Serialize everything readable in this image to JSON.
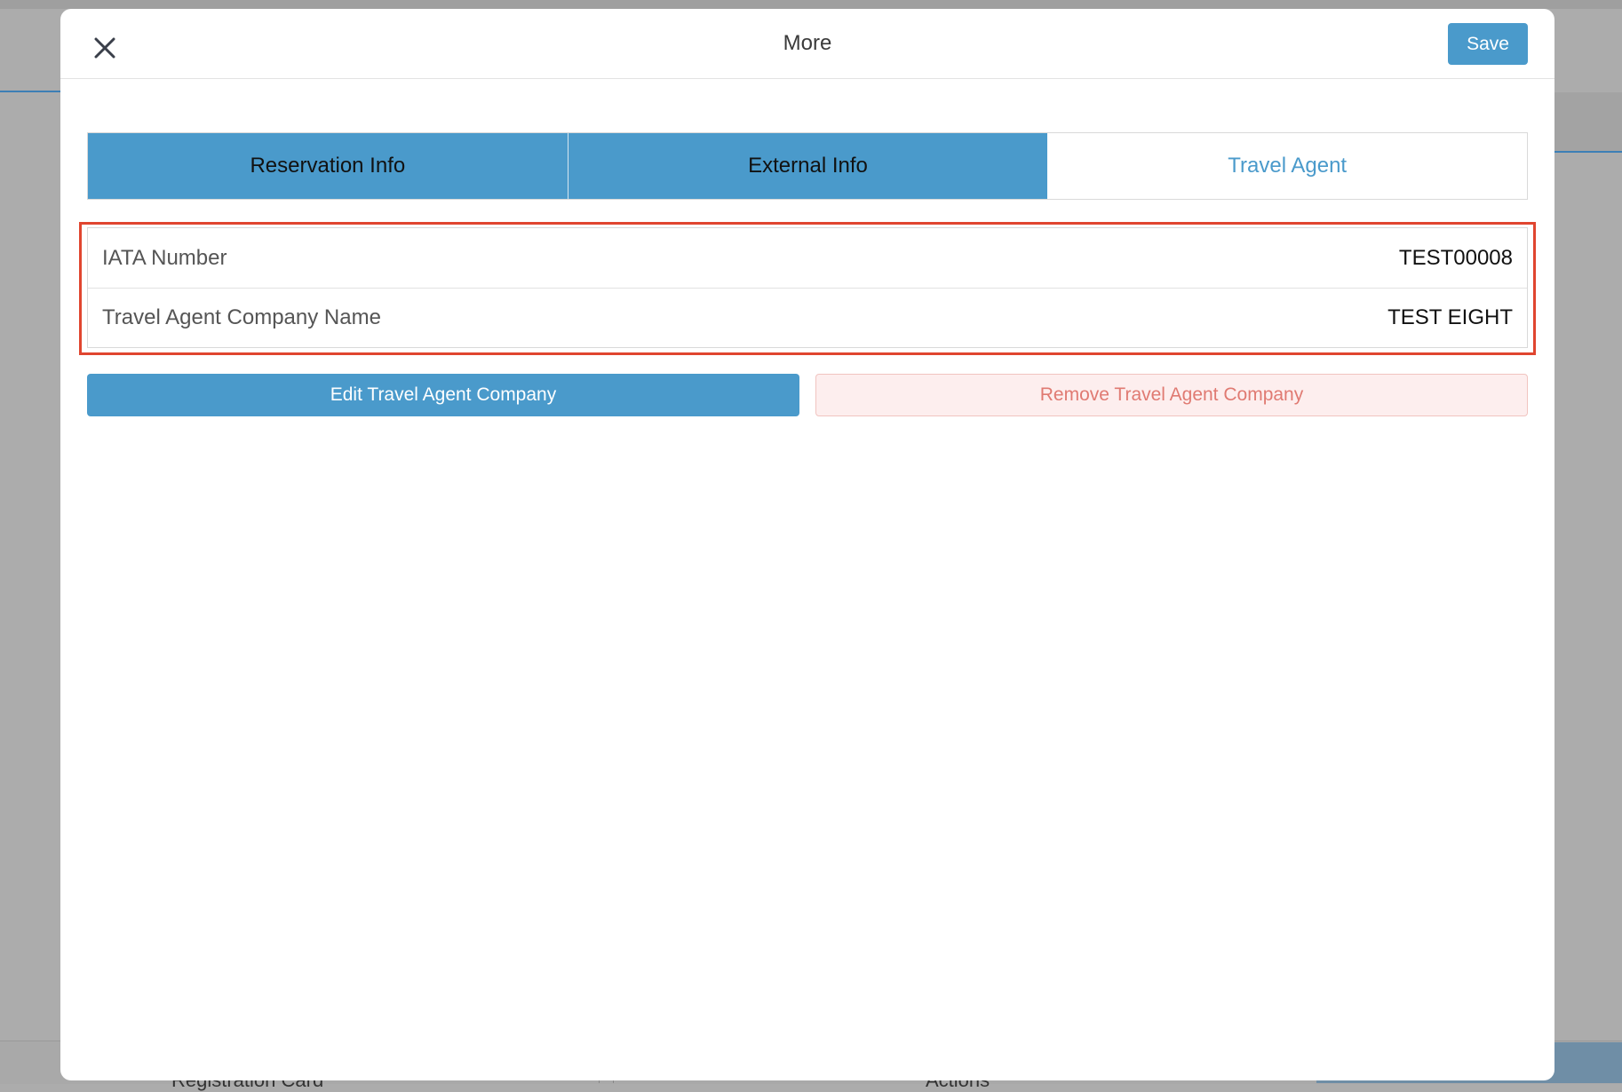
{
  "background": {
    "bottom_left_text": "Registration Card",
    "bottom_center_text": "Actions"
  },
  "modal": {
    "title": "More",
    "close_icon": "close-icon",
    "save_label": "Save"
  },
  "tabs": [
    {
      "label": "Reservation Info",
      "active": false
    },
    {
      "label": "External Info",
      "active": false
    },
    {
      "label": "Travel Agent",
      "active": true
    }
  ],
  "travel_agent": {
    "rows": [
      {
        "label": "IATA Number",
        "value": "TEST00008"
      },
      {
        "label": "Travel Agent Company Name",
        "value": "TEST EIGHT"
      }
    ],
    "edit_label": "Edit Travel Agent Company",
    "remove_label": "Remove Travel Agent Company"
  },
  "colors": {
    "accent": "#4a9acb",
    "highlight": "#e0452f",
    "danger_text": "#e07a72",
    "danger_bg": "#fdeeee"
  }
}
